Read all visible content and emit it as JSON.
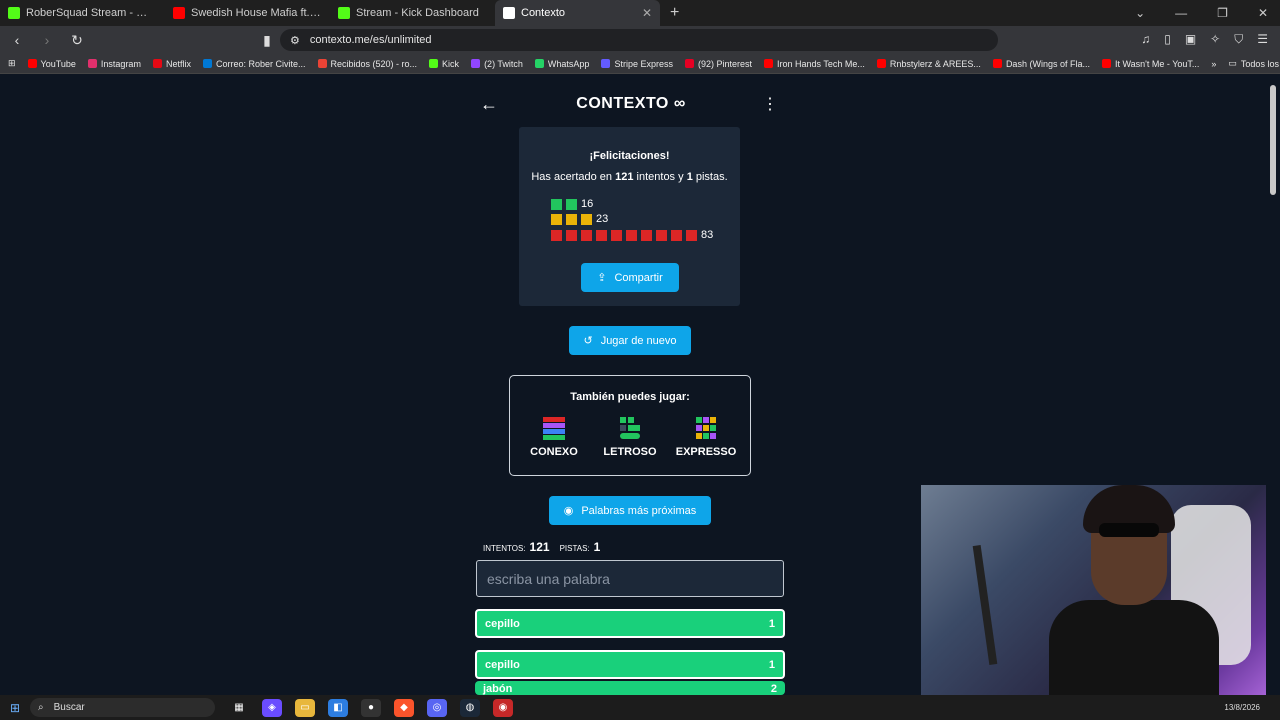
{
  "browser": {
    "tabs": [
      {
        "title": "RoberSquad Stream - Watch Live",
        "fav_color": "#53fc18"
      },
      {
        "title": "Swedish House Mafia ft. John Ma",
        "fav_color": "#ff0000"
      },
      {
        "title": "Stream - Kick Dashboard",
        "fav_color": "#53fc18"
      },
      {
        "title": "Contexto",
        "fav_color": "#ffffff"
      }
    ],
    "url": "contexto.me/es/unlimited",
    "bookmarks": [
      {
        "label": "YouTube",
        "color": "#ff0000"
      },
      {
        "label": "Instagram",
        "color": "#e1306c"
      },
      {
        "label": "Netflix",
        "color": "#e50914"
      },
      {
        "label": "Correo: Rober Civite...",
        "color": "#0078d4"
      },
      {
        "label": "Recibidos (520) - ro...",
        "color": "#ea4335"
      },
      {
        "label": "Kick",
        "color": "#53fc18"
      },
      {
        "label": "(2) Twitch",
        "color": "#9146ff"
      },
      {
        "label": "WhatsApp",
        "color": "#25d366"
      },
      {
        "label": "Stripe Express",
        "color": "#635bff"
      },
      {
        "label": "(92) Pinterest",
        "color": "#e60023"
      },
      {
        "label": "Iron Hands Tech Me...",
        "color": "#ff0000"
      },
      {
        "label": "Rnbstylerz & AREES...",
        "color": "#ff0000"
      },
      {
        "label": "Dash (Wings of Fla...",
        "color": "#ff0000"
      },
      {
        "label": "It Wasn't Me - YouT...",
        "color": "#ff0000"
      }
    ],
    "bookmarks_folder": "Todos los favoritos"
  },
  "header": {
    "title": "CONTEXTO ∞"
  },
  "result": {
    "congrats": "¡Felicitaciones!",
    "line_prefix": "Has acertado en",
    "attempts": "121",
    "line_mid": "intentos y",
    "hints": "1",
    "line_suffix": "pistas.",
    "rows": [
      {
        "color": "#22c55e",
        "count": 2,
        "value": "16"
      },
      {
        "color": "#eab308",
        "count": 3,
        "value": "23"
      },
      {
        "color": "#dc2626",
        "count": 10,
        "value": "83"
      }
    ],
    "share_label": "Compartir"
  },
  "play_again_label": "Jugar de nuevo",
  "also_play": {
    "title": "También puedes jugar:",
    "games": [
      {
        "label": "CONEXO"
      },
      {
        "label": "LETROSO"
      },
      {
        "label": "EXPRESSO"
      }
    ]
  },
  "closest_words_label": "Palabras más próximas",
  "stats": {
    "attempts_label": "INTENTOS:",
    "attempts_value": "121",
    "hints_label": "PISTAS:",
    "hints_value": "1"
  },
  "input": {
    "placeholder": "escriba una palabra"
  },
  "guesses": [
    {
      "word": "cepillo",
      "rank": "1"
    },
    {
      "word": "cepillo",
      "rank": "1"
    },
    {
      "word": "jabón",
      "rank": "2"
    }
  ],
  "taskbar": {
    "search_label": "Buscar",
    "date": "13/8/2026"
  }
}
